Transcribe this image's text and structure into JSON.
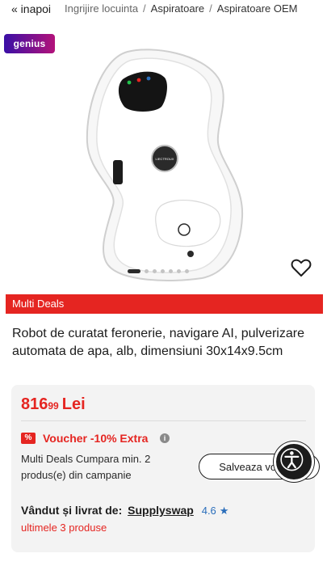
{
  "nav": {
    "back_label": "« inapoi",
    "breadcrumbs": [
      "Ingrijire locuinta",
      "Aspiratoare",
      "Aspiratoare OEM"
    ],
    "separator": "/"
  },
  "badge": {
    "genius_label": "genius"
  },
  "gallery": {
    "slide_count": 7,
    "active_index": 0
  },
  "deals_bar": {
    "label": "Multi Deals"
  },
  "product": {
    "title": "Robot de curatat feronerie, navigare AI, pulverizare automata de apa, alb, dimensiuni 30x14x9.5cm",
    "price_integer": "816",
    "price_decimals": "99",
    "currency": "Lei"
  },
  "voucher": {
    "badge": "%",
    "text": "Voucher -10% Extra",
    "info_icon": "i"
  },
  "campaign": {
    "text": "Multi Deals Cumpara min. 2 produs(e) din campanie"
  },
  "actions": {
    "save_label": "Salveaza voucherul"
  },
  "seller": {
    "label": "Vândut și livrat de:",
    "name": "Supplyswap",
    "rating": "4.6",
    "star": "★"
  },
  "stock": {
    "text": "ultimele 3 produse"
  },
  "colors": {
    "accent_red": "#e52521",
    "rating_blue": "#2a6ebb"
  }
}
